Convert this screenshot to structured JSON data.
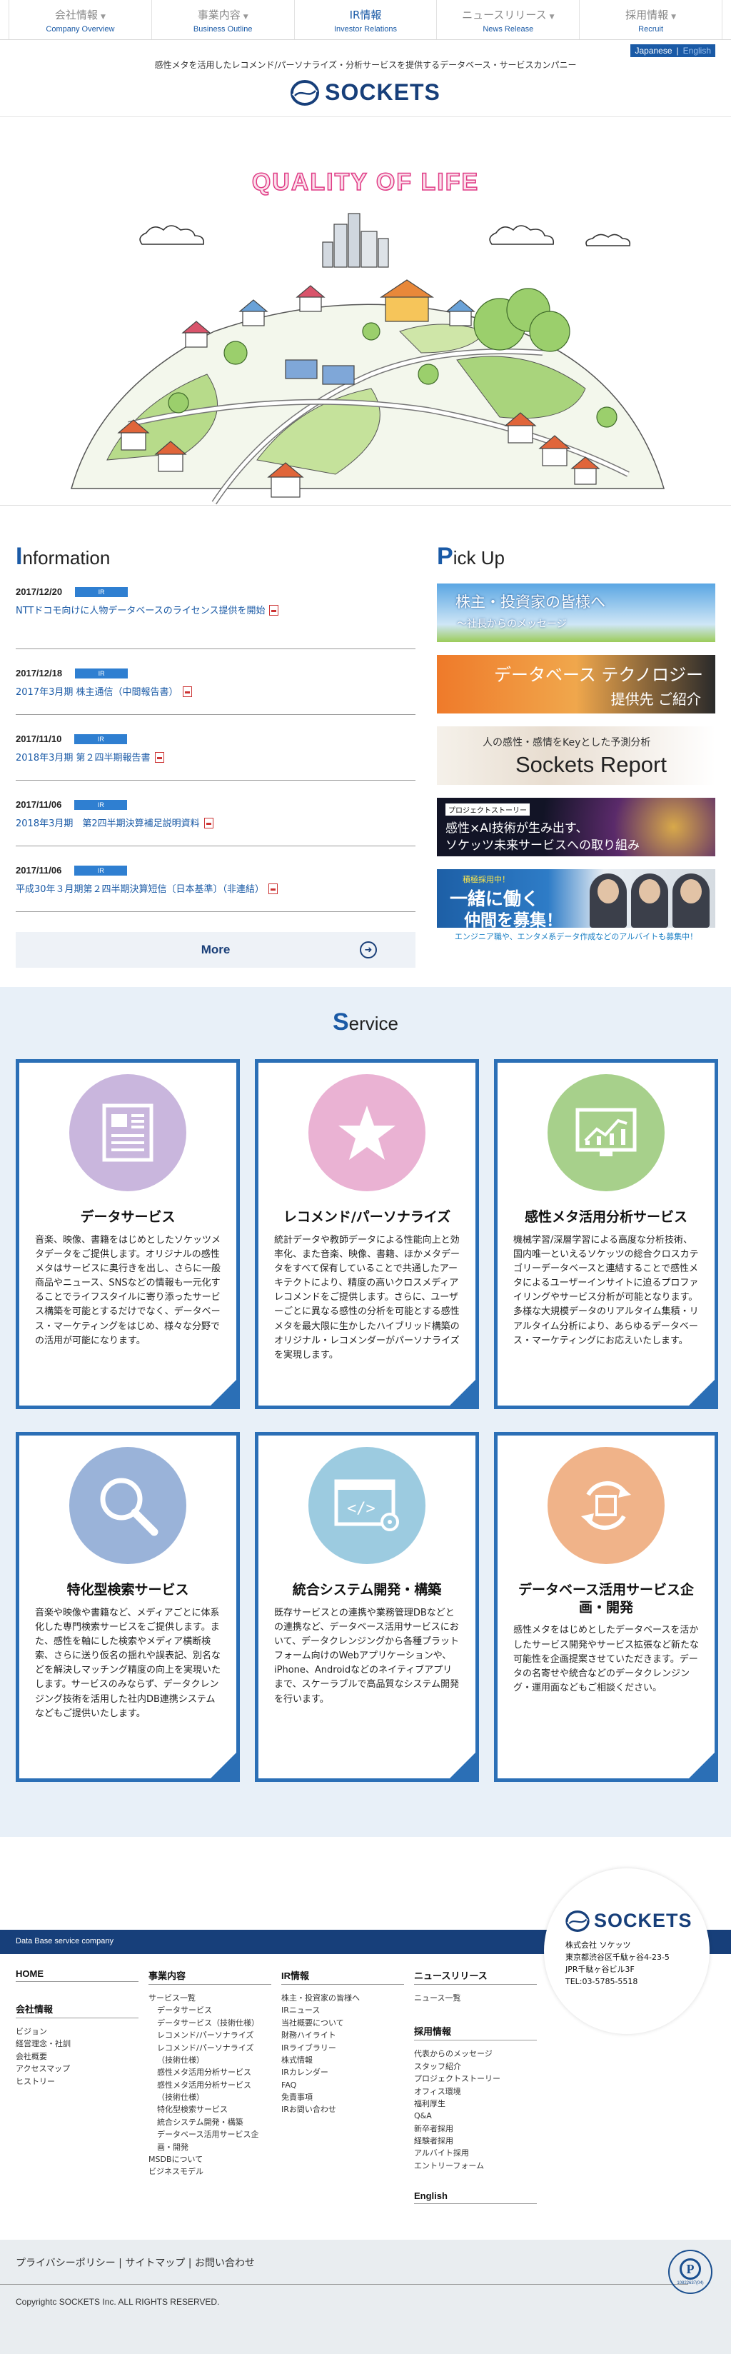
{
  "nav": [
    {
      "jp": "会社情報",
      "en": "Company Overview",
      "dropdown": true,
      "active": false
    },
    {
      "jp": "事業内容",
      "en": "Business Outline",
      "dropdown": true,
      "active": false
    },
    {
      "jp": "IR情報",
      "en": "Investor Relations",
      "dropdown": false,
      "active": true
    },
    {
      "jp": "ニュースリリース",
      "en": "News Release",
      "dropdown": true,
      "active": false
    },
    {
      "jp": "採用情報",
      "en": "Recruit",
      "dropdown": true,
      "active": false
    }
  ],
  "header": {
    "lang_japanese": "Japanese",
    "lang_sep": "|",
    "lang_english": "English",
    "tagline": "感性メタを活用したレコメンド/パーソナライズ・分析サービスを提供するデータベース・サービスカンパニー",
    "logo_text": "SOCKETS"
  },
  "hero": {
    "title": "QUALITY OF LIFE"
  },
  "info": {
    "head_cap": "I",
    "head_rest": "nformation",
    "items": [
      {
        "date": "2017/12/20",
        "badge": "IR",
        "title": "NTTドコモ向けに人物データベースのライセンス提供を開始"
      },
      {
        "date": "2017/12/18",
        "badge": "IR",
        "title": "2017年3月期 株主通信（中間報告書）"
      },
      {
        "date": "2017/11/10",
        "badge": "IR",
        "title": "2018年3月期 第２四半期報告書"
      },
      {
        "date": "2017/11/06",
        "badge": "IR",
        "title": "2018年3月期　第2四半期決算補足説明資料"
      },
      {
        "date": "2017/11/06",
        "badge": "IR",
        "title": "平成30年３月期第２四半期決算短信〔日本基準〕（非連結）"
      }
    ],
    "more": "More"
  },
  "pickup": {
    "head_cap": "P",
    "head_rest": "ick Up",
    "banners": {
      "b1_line1": "株主・投資家の皆様へ",
      "b1_line2": "〜社長からのメッセージ",
      "b2_line1": "データベース テクノロジー",
      "b2_line2": "提供先 ご紹介",
      "b3_line1": "人の感性・感情をKeyとした予測分析",
      "b3_line2": "Sockets Report",
      "b4_tag": "プロジェクトストーリー",
      "b4_line1": "感性×AI技術が生み出す、",
      "b4_line2": "ソケッツ未来サービスへの取り組み",
      "b5_tag": "積極採用中！",
      "b5_line1": "一緒に働く",
      "b5_line2": "仲間を募集！"
    },
    "note": "エンジニア職や、エンタメ系データ作成などのアルバイトも募集中！"
  },
  "service": {
    "head_cap": "S",
    "head_rest": "ervice",
    "cards": [
      {
        "title": "データサービス",
        "color": "#c9b6dd",
        "icon": "document-icon",
        "desc": "音楽、映像、書籍をはじめとしたソケッツメタデータをご提供します。オリジナルの感性メタはサービスに奥行きを出し、さらに一般商品やニュース、SNSなどの情報も一元化することでライフスタイルに寄り添ったサービス構築を可能とするだけでなく、データベース・マーケティングをはじめ、様々な分野での活用が可能になります。"
      },
      {
        "title": "レコメンド/パーソナライズ",
        "color": "#eab2d3",
        "icon": "star-icon",
        "desc": "統計データや教師データによる性能向上と効率化、また音楽、映像、書籍、ほかメタデータをすべて保有していることで共通したアーキテクトにより、精度の高いクロスメディアレコメンドをご提供します。さらに、ユーザーごとに異なる感性の分析を可能とする感性メタを最大限に生かしたハイブリッド構築のオリジナル・レコメンダーがパーソナライズを実現します。"
      },
      {
        "title": "感性メタ活用分析サービス",
        "color": "#a7d08b",
        "icon": "chart-icon",
        "desc": "機械学習/深層学習による高度な分析技術、国内唯一といえるソケッツの総合クロスカテゴリーデータベースと連結することで感性メタによるユーザーインサイトに迫るプロファイリングやサービス分析が可能となります。多様な大規模データのリアルタイム集積・リアルタイム分析により、あらゆるデータベース・マーケティングにお応えいたします。"
      },
      {
        "title": "特化型検索サービス",
        "color": "#9ab3d9",
        "icon": "magnifier-icon",
        "desc": "音楽や映像や書籍など、メディアごとに体系化した専門検索サービスをご提供します。また、感性を軸にした検索やメディア横断検索、さらに送り仮名の揺れや誤表記、別名などを解決しマッチング精度の向上を実現いたします。サービスのみならず、データクレンジング技術を活用した社内DB連携システムなどもご提供いたします。"
      },
      {
        "title": "統合システム開発・構築",
        "color": "#9ccbe0",
        "icon": "code-window-icon",
        "desc": "既存サービスとの連携や業務管理DBなどとの連携など、データベース活用サービスにおいて、データクレンジングから各種プラットフォーム向けのWebアプリケーションや、iPhone、Androidなどのネイティブアプリまで、スケーラブルで高品質なシステム開発を行います。"
      },
      {
        "title": "データベース活用サービス企画・開発",
        "color": "#f0b389",
        "icon": "cycle-icon",
        "desc": "感性メタをはじめとしたデータベースを活かしたサービス開発やサービス拡張など新たな可能性を企画提案させていただきます。データの名寄せや統合などのデータクレンジング・運用面などもご相談ください。"
      }
    ]
  },
  "footer": {
    "band_label": "Data Base service company",
    "company": {
      "logo_text": "SOCKETS",
      "name": "株式会社 ソケッツ",
      "addr1": "東京都渋谷区千駄ヶ谷4-23-5",
      "addr2": "JPR千駄ヶ谷ビル3F",
      "tel": "TEL:03-5785-5518"
    },
    "col1": {
      "home": "HOME",
      "company_head": "会社情報",
      "company_links": [
        "ビジョン",
        "経営理念・社訓",
        "会社概要",
        "アクセスマップ",
        "ヒストリー"
      ]
    },
    "col2": {
      "head": "事業内容",
      "links": [
        "サービス一覧",
        "データサービス",
        "データサービス（技術仕様）",
        "レコメンド/パーソナライズ",
        "レコメンド/パーソナライズ",
        "（技術仕様）",
        "感性メタ活用分析サービス",
        "感性メタ活用分析サービス",
        "（技術仕様）",
        "特化型検索サービス",
        "統合システム開発・構築",
        "データベース活用サービス企",
        "画・開発",
        "MSDBについて",
        "ビジネスモデル"
      ]
    },
    "col3": {
      "head": "IR情報",
      "links": [
        "株主・投資家の皆様へ",
        "IRニュース",
        "当社概要について",
        "財務ハイライト",
        "IRライブラリー",
        "株式情報",
        "IRカレンダー",
        "FAQ",
        "免責事項",
        "IRお問い合わせ"
      ]
    },
    "col4": {
      "news_head": "ニュースリリース",
      "news_links": [
        "ニュース一覧"
      ],
      "recruit_head": "採用情報",
      "recruit_links": [
        "代表からのメッセージ",
        "スタッフ紹介",
        "プロジェクトストーリー",
        "オフィス環境",
        "福利厚生",
        "Q&A",
        "新卒者採用",
        "経験者採用",
        "アルバイト採用",
        "エントリーフォーム"
      ],
      "english": "English"
    },
    "policy": "プライバシーポリシー | サイトマップ | お問い合わせ",
    "copyright": "Copyrightc SOCKETS Inc. ALL RIGHTS RESERVED.",
    "privacy_mark_num": "10822637(04)"
  }
}
